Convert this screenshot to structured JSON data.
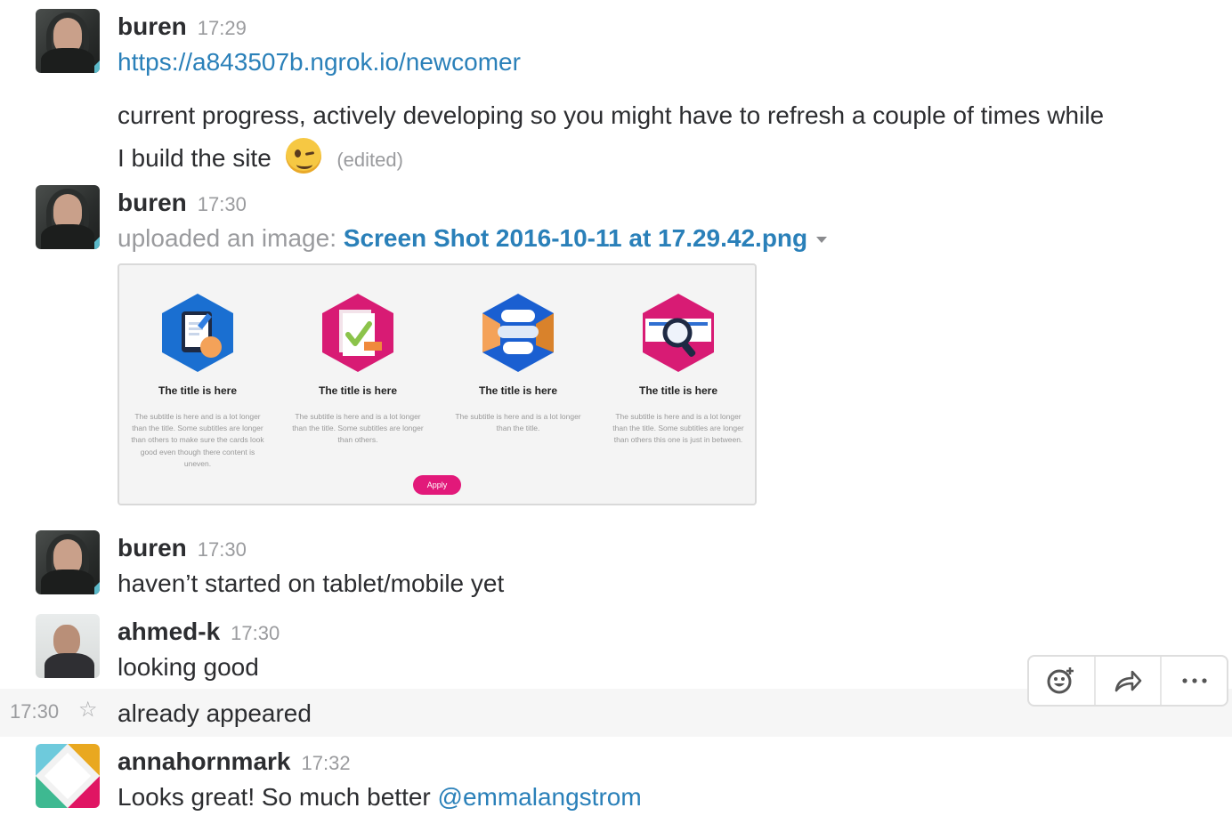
{
  "messages": [
    {
      "sender": "buren",
      "time": "17:29",
      "link": "https://a843507b.ngrok.io/newcomer",
      "text_line1": "current progress, actively developing so you might have to refresh a couple of times while",
      "text_line2": "I build the site",
      "edited": "(edited)",
      "emoji": "wink-emoji"
    },
    {
      "sender": "buren",
      "time": "17:30",
      "upload_prefix": "uploaded an image:",
      "file_name": "Screen Shot 2016-10-11 at 17.29.42.png",
      "preview": {
        "cards": [
          {
            "title": "The title is here",
            "subtitle": "The subtitle is here and is a lot longer than the title. Some subtitles are longer than others to make sure the cards look good even though there content is uneven."
          },
          {
            "title": "The title is here",
            "subtitle": "The subtitle is here and is a lot longer than the title. Some subtitles are longer than others."
          },
          {
            "title": "The title is here",
            "subtitle": "The subtitle is here and is a lot longer than the title."
          },
          {
            "title": "The title is here",
            "subtitle": "The subtitle is here and is a lot longer than the title. Some subtitles are longer than others this one is just in between."
          }
        ],
        "button": "Apply"
      }
    },
    {
      "sender": "buren",
      "time": "17:30",
      "text": "haven’t started on tablet/mobile yet"
    },
    {
      "sender": "ahmed-k",
      "time": "17:30",
      "text": "looking good"
    },
    {
      "time": "17:30",
      "text": "already appeared"
    },
    {
      "sender": "annahornmark",
      "time": "17:32",
      "text": "Looks great! So much better",
      "mention": "@emmalangstrom"
    }
  ],
  "message_actions": [
    "add-reaction-icon",
    "share-icon",
    "more-icon"
  ],
  "colors": {
    "link": "#2a80b9",
    "muted": "#9a9b9e",
    "apply_button": "#e2197a",
    "hover_row": "#f6f6f6"
  }
}
